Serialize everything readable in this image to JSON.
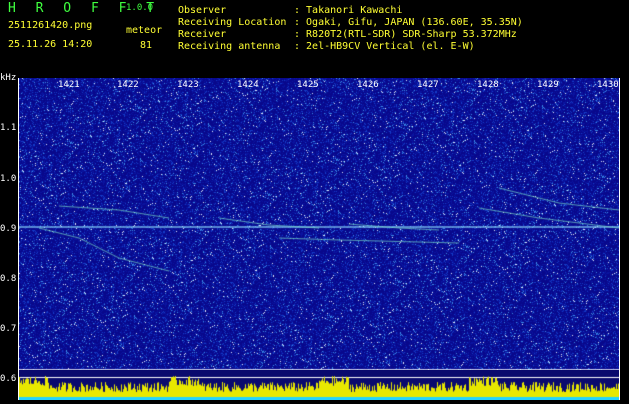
{
  "app": {
    "name": "H R O F F T",
    "version": "1.0.0"
  },
  "file": {
    "name": "2511261420.png",
    "datetime": "25.11.26 14:20"
  },
  "meteor": {
    "label": "meteor",
    "count": "81"
  },
  "info": [
    {
      "key": "Observer",
      "value": ": Takanori Kawachi"
    },
    {
      "key": "Receiving Location",
      "value": ": Ogaki, Gifu, JAPAN (136.60E, 35.35N)"
    },
    {
      "key": "Receiver",
      "value": ": R820T2(RTL-SDR) SDR-Sharp 53.372MHz"
    },
    {
      "key": "Receiving antenna",
      "value": ": 2el-HB9CV Vertical (el. E-W)"
    }
  ],
  "y_axis": {
    "unit": "kHz",
    "ticks": [
      "1.1",
      "1.0",
      "0.9",
      "0.8",
      "0.7",
      "0.6"
    ]
  },
  "x_axis": {
    "ticks": [
      "1421",
      "1422",
      "1423",
      "1424",
      "1425",
      "1426",
      "1427",
      "1428",
      "1429",
      "1430"
    ]
  },
  "colors": {
    "background": "#000000",
    "title": "#3fff3f",
    "text": "#ffff33",
    "spectrogram_bg": "#08088f"
  }
}
